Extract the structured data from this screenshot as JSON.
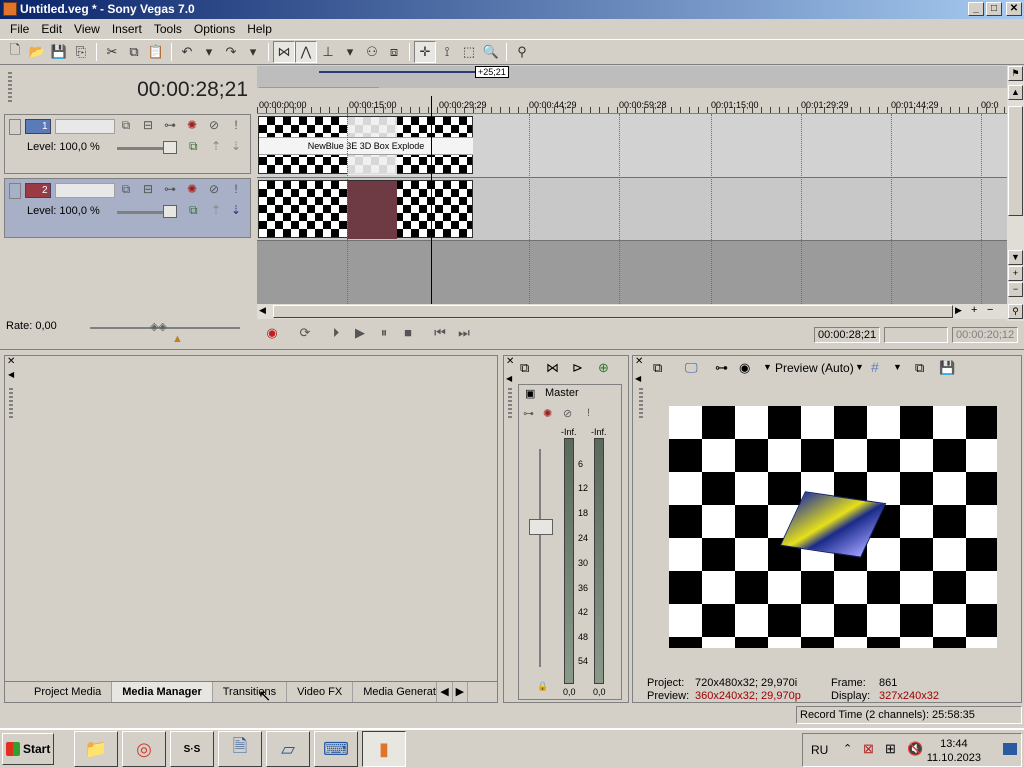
{
  "window": {
    "title": "Untitled.veg * - Sony Vegas 7.0",
    "min": "_",
    "max": "□",
    "close": "✕"
  },
  "menu": [
    "File",
    "Edit",
    "View",
    "Insert",
    "Tools",
    "Options",
    "Help"
  ],
  "timecode": "00:00:28;21",
  "tracks": [
    {
      "number": "1",
      "level": "Level: 100,0 %"
    },
    {
      "number": "2",
      "level": "Level: 100,0 %"
    }
  ],
  "ruler": {
    "labels": [
      "00:00:00;00",
      "00:00:15;00",
      "00:00:29;29",
      "00:00:44;29",
      "00:00:59;28",
      "00:01:15;00",
      "00:01:29;29",
      "00:01:44;29",
      "00:0"
    ],
    "cursor_offset": "+25;21"
  },
  "clip_fx_label": "NewBlue 3E 3D Box Explode",
  "transport": {
    "rate": "Rate: 0,00",
    "time_current": "00:00:28;21",
    "time_length": "00:00:20;12"
  },
  "tabs": [
    {
      "label": "Project Media",
      "active": false
    },
    {
      "label": "Media Manager",
      "active": true
    },
    {
      "label": "Transitions",
      "active": false
    },
    {
      "label": "Video FX",
      "active": false
    },
    {
      "label": "Media Generato",
      "active": false
    }
  ],
  "mixer": {
    "title": "Master",
    "peak_left": "-Inf.",
    "peak_right": "-Inf.",
    "scale": [
      "6",
      "12",
      "18",
      "24",
      "30",
      "36",
      "42",
      "48",
      "54"
    ],
    "value_left": "0,0",
    "value_right": "0,0"
  },
  "preview": {
    "mode": "Preview (Auto)",
    "project_label": "Project:",
    "project_value": "720x480x32; 29,970i",
    "preview_label": "Preview:",
    "preview_value": "360x240x32; 29,970p",
    "frame_label": "Frame:",
    "frame_value": "861",
    "display_label": "Display:",
    "display_value": "327x240x32"
  },
  "status": "Record Time (2 channels): 25:58:35",
  "taskbar": {
    "start": "Start",
    "lang": "RU",
    "time": "13:44",
    "date": "11.10.2023"
  },
  "colors": {
    "titlebar_start": "#0a246a",
    "track1": "#5a7ab8",
    "track2": "#9a3a44",
    "preview_red": "#a00000"
  }
}
